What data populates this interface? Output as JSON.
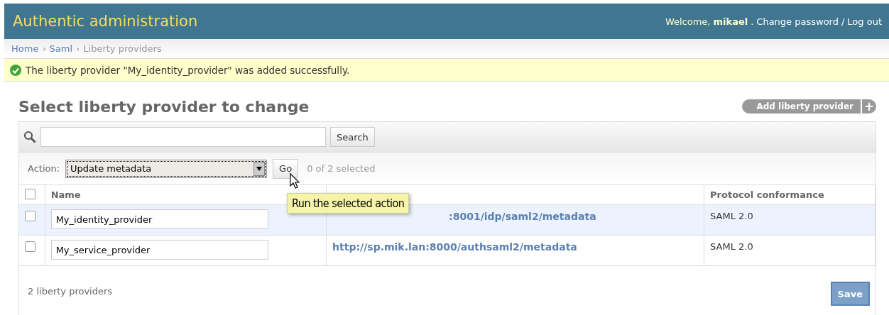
{
  "header": {
    "title": "Authentic administration",
    "welcome": "Welcome,",
    "user": "mikael",
    "user_suffix": ".",
    "links": [
      {
        "label": "Change password"
      },
      {
        "label": "Log out"
      }
    ],
    "link_separator": "/"
  },
  "breadcrumbs": [
    {
      "label": "Home",
      "current": false
    },
    {
      "label": "Saml",
      "current": false
    },
    {
      "label": "Liberty providers",
      "current": true
    }
  ],
  "breadcrumb_separator": "›",
  "message": {
    "kind": "success",
    "text": "The liberty provider \"My_identity_provider\" was added successfully."
  },
  "page_title": "Select liberty provider to change",
  "add_button": {
    "label": "Add liberty provider",
    "icon": "+"
  },
  "search": {
    "button": "Search"
  },
  "actions": {
    "label": "Action:",
    "selected_option": "Update metadata",
    "go_button": "Go",
    "counter": "0 of 2 selected"
  },
  "tooltip": "Run the selected action",
  "table": {
    "select_all_checked": false,
    "columns": [
      {
        "label": "Name"
      },
      {},
      {
        "label": "Protocol conformance"
      }
    ],
    "rows": [
      {
        "checked": false,
        "highlighted": true,
        "name": "My_identity_provider",
        "url": ":8001/idp/saml2/metadata",
        "url_partly_covered": true,
        "protocol": "SAML 2.0"
      },
      {
        "checked": false,
        "highlighted": false,
        "name": "My_service_provider",
        "url": "http://sp.mik.lan:8000/authsaml2/metadata",
        "url_partly_covered": false,
        "protocol": "SAML 2.0"
      }
    ]
  },
  "footer": {
    "count": "2 liberty providers",
    "save_button": "Save"
  }
}
